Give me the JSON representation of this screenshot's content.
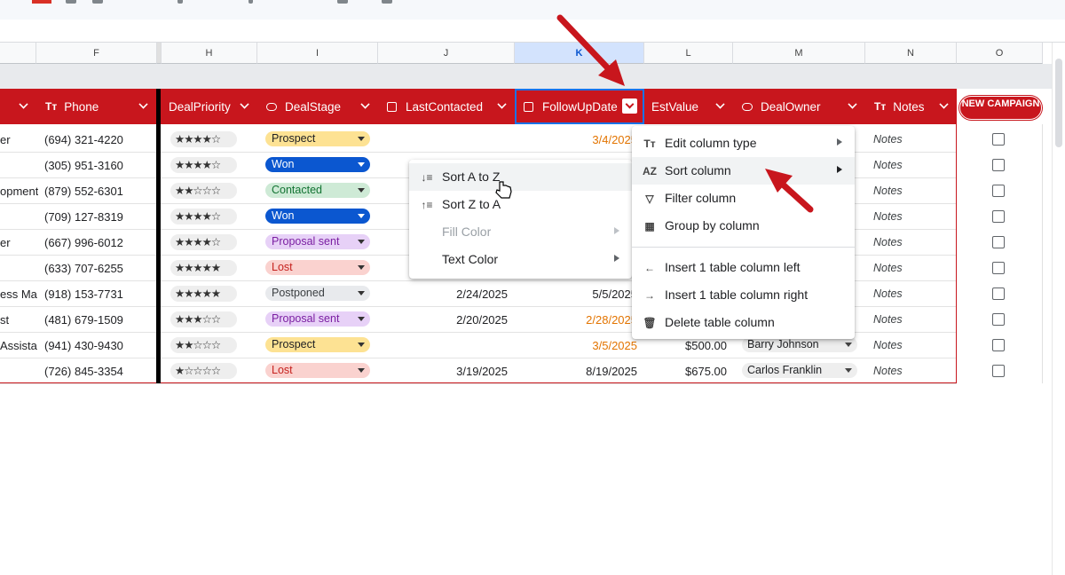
{
  "columns": {
    "F": "F",
    "H": "H",
    "I": "I",
    "J": "J",
    "K": "K",
    "L": "L",
    "M": "M",
    "N": "N",
    "O": "O"
  },
  "headers": {
    "phone": "Phone",
    "deal_priority": "DealPriority",
    "deal_stage": "DealStage",
    "last_contacted": "LastContacted",
    "follow_up_date": "FollowUpDate",
    "est_value": "EstValue",
    "deal_owner": "DealOwner",
    "notes": "Notes",
    "new_campaign": "NEW CAMPAIGN"
  },
  "rows": [
    {
      "title": "er",
      "phone": "(694) 321-4220",
      "stars": "★★★★☆",
      "stage": "Prospect",
      "stage_style": "prospect",
      "last": "",
      "follow": "3/4/2025",
      "follow_style": "orange",
      "value": "",
      "owner": "",
      "notes": "Notes"
    },
    {
      "title": "",
      "phone": "(305) 951-3160",
      "stars": "★★★★☆",
      "stage": "Won",
      "stage_style": "won",
      "last": "",
      "follow": "",
      "follow_style": "",
      "value": "",
      "owner": "",
      "notes": "Notes"
    },
    {
      "title": "opment",
      "phone": "(879) 552-6301",
      "stars": "★★☆☆☆",
      "stage": "Contacted",
      "stage_style": "contacted",
      "last": "",
      "follow": "",
      "follow_style": "",
      "value": "",
      "owner": "",
      "notes": "Notes"
    },
    {
      "title": "",
      "phone": "(709) 127-8319",
      "stars": "★★★★☆",
      "stage": "Won",
      "stage_style": "won",
      "last": "",
      "follow": "",
      "follow_style": "",
      "value": "",
      "owner": "",
      "notes": "Notes"
    },
    {
      "title": "er",
      "phone": "(667) 996-6012",
      "stars": "★★★★☆",
      "stage": "Proposal sent",
      "stage_style": "proposal",
      "last": "",
      "follow": "",
      "follow_style": "",
      "value": "",
      "owner": "",
      "notes": "Notes"
    },
    {
      "title": "",
      "phone": "(633) 707-6255",
      "stars": "★★★★★",
      "stage": "Lost",
      "stage_style": "lost",
      "last": "",
      "follow": "",
      "follow_style": "",
      "value": "",
      "owner": "",
      "notes": "Notes"
    },
    {
      "title": "ess Ma",
      "phone": "(918) 153-7731",
      "stars": "★★★★★",
      "stage": "Postponed",
      "stage_style": "postponed",
      "last": "2/24/2025",
      "follow": "5/5/2025",
      "follow_style": "",
      "value": "",
      "owner": "",
      "notes": "Notes"
    },
    {
      "title": "st",
      "phone": "(481) 679-1509",
      "stars": "★★★☆☆",
      "stage": "Proposal sent",
      "stage_style": "proposal",
      "last": "2/20/2025",
      "follow": "2/28/2025",
      "follow_style": "orange",
      "value": "",
      "owner": "",
      "notes": "Notes"
    },
    {
      "title": "Assista",
      "phone": "(941) 430-9430",
      "stars": "★★☆☆☆",
      "stage": "Prospect",
      "stage_style": "prospect",
      "last": "",
      "follow": "3/5/2025",
      "follow_style": "orange",
      "value": "$500.00",
      "owner": "Barry Johnson",
      "notes": "Notes"
    },
    {
      "title": "",
      "phone": "(726) 845-3354",
      "stars": "★☆☆☆☆",
      "stage": "Lost",
      "stage_style": "lost",
      "last": "3/19/2025",
      "follow": "8/19/2025",
      "follow_style": "",
      "value": "$675.00",
      "owner": "Carlos Franklin",
      "notes": "Notes"
    }
  ],
  "column_menu": {
    "edit_type": "Edit column type",
    "sort": "Sort column",
    "filter": "Filter column",
    "group": "Group by column",
    "insert_left": "Insert 1 table column left",
    "insert_right": "Insert 1 table column right",
    "delete": "Delete table column"
  },
  "sort_menu": {
    "a_to_z": "Sort A to Z",
    "z_to_a": "Sort Z to A",
    "fill_color": "Fill Color",
    "text_color": "Text Color"
  },
  "colors": {
    "accent": "#c8161d",
    "annotation_arrow": "#c8161d",
    "selection": "#1a73e8",
    "orange_date": "#e37400"
  },
  "icons": {
    "text_type": "text-type-icon",
    "dropdown_chip": "chip-icon",
    "calendar": "calendar-icon",
    "sort_az": "sort-az-icon",
    "filter": "filter-icon",
    "group": "table-icon",
    "arrow_left": "arrow-left-icon",
    "arrow_right": "arrow-right-icon",
    "trash": "trash-icon"
  }
}
